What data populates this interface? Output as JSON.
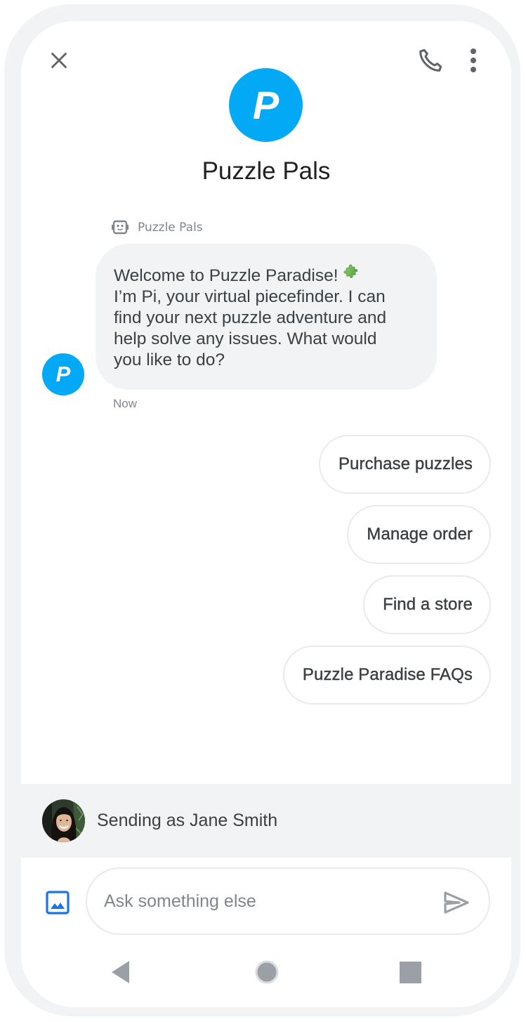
{
  "header": {
    "close_icon": "close-icon",
    "phone_icon": "phone-icon",
    "more_icon": "more-vert-icon",
    "brand_initial": "P",
    "brand_name": "Puzzle Pals",
    "brand_color": "#03a9f4"
  },
  "conversation": {
    "sender_label": "Puzzle Pals",
    "sender_icon": "bot-icon",
    "bot_initial": "P",
    "message_lines": [
      "Welcome to Puzzle Paradise!",
      "I’m Pi, your virtual piecefinder. I can",
      "find your next puzzle adventure and",
      "help solve any issues. What would",
      "you like to do?"
    ],
    "message_emoji": "puzzle-piece-icon",
    "timestamp": "Now"
  },
  "suggestions": [
    {
      "label": "Purchase puzzles"
    },
    {
      "label": "Manage order"
    },
    {
      "label": "Find a store"
    },
    {
      "label": "Puzzle Paradise FAQs"
    }
  ],
  "sending_as": {
    "text": "Sending as Jane Smith",
    "avatar": "user-avatar-photo"
  },
  "compose": {
    "gallery_icon": "image-icon",
    "placeholder": "Ask something else",
    "value": "",
    "send_icon": "send-icon",
    "accent_color": "#1a73e8"
  },
  "system_nav": {
    "back_icon": "back-icon",
    "home_icon": "home-icon",
    "recents_icon": "recents-icon"
  }
}
